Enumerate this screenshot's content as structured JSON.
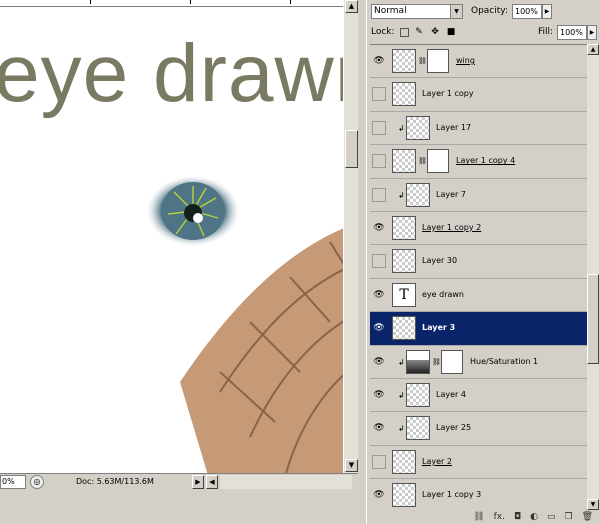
{
  "canvas": {
    "title_text": "eye drawn",
    "zoom_value": "0%",
    "doc_info": "Doc: 5.63M/113.6M"
  },
  "layers_panel": {
    "blend_mode": "Normal",
    "opacity_label": "Opacity:",
    "opacity_value": "100%",
    "lock_label": "Lock:",
    "fill_label": "Fill:",
    "fill_value": "100%",
    "layers": [
      {
        "name": "wing",
        "visible": true,
        "clipped": false,
        "has_mask": true,
        "thumb": "checker",
        "underlined": true,
        "selected": false
      },
      {
        "name": "Layer 1 copy",
        "visible": false,
        "clipped": false,
        "has_mask": false,
        "thumb": "checker",
        "underlined": false,
        "selected": false
      },
      {
        "name": "Layer 17",
        "visible": false,
        "clipped": true,
        "has_mask": false,
        "thumb": "checker",
        "underlined": false,
        "selected": false
      },
      {
        "name": "Layer 1 copy 4",
        "visible": false,
        "clipped": false,
        "has_mask": true,
        "thumb": "checker",
        "underlined": true,
        "selected": false
      },
      {
        "name": "Layer 7",
        "visible": false,
        "clipped": true,
        "has_mask": false,
        "thumb": "checker",
        "underlined": false,
        "selected": false
      },
      {
        "name": "Layer 1 copy 2",
        "visible": true,
        "clipped": false,
        "has_mask": false,
        "thumb": "checker",
        "underlined": true,
        "selected": false
      },
      {
        "name": "Layer 30",
        "visible": false,
        "clipped": false,
        "has_mask": false,
        "thumb": "checker",
        "underlined": false,
        "selected": false
      },
      {
        "name": "eye drawn",
        "visible": true,
        "clipped": false,
        "has_mask": false,
        "thumb": "text",
        "underlined": false,
        "selected": false
      },
      {
        "name": "Layer 3",
        "visible": true,
        "clipped": false,
        "has_mask": false,
        "thumb": "checker",
        "underlined": false,
        "selected": true
      },
      {
        "name": "Hue/Saturation 1",
        "visible": true,
        "clipped": true,
        "has_mask": true,
        "thumb": "adjust",
        "underlined": false,
        "selected": false
      },
      {
        "name": "Layer 4",
        "visible": true,
        "clipped": true,
        "has_mask": false,
        "thumb": "checker",
        "underlined": false,
        "selected": false
      },
      {
        "name": "Layer 25",
        "visible": true,
        "clipped": true,
        "has_mask": false,
        "thumb": "checker",
        "underlined": false,
        "selected": false
      },
      {
        "name": "Layer 2",
        "visible": false,
        "clipped": false,
        "has_mask": false,
        "thumb": "checker",
        "underlined": true,
        "selected": false
      },
      {
        "name": "Layer 1 copy 3",
        "visible": true,
        "clipped": false,
        "has_mask": false,
        "thumb": "checker",
        "underlined": false,
        "selected": false
      }
    ],
    "bottom_icons": [
      "link-icon",
      "fx-icon",
      "mask-icon",
      "adjustment-icon",
      "group-folder-icon",
      "new-layer-icon",
      "trash-icon"
    ]
  }
}
